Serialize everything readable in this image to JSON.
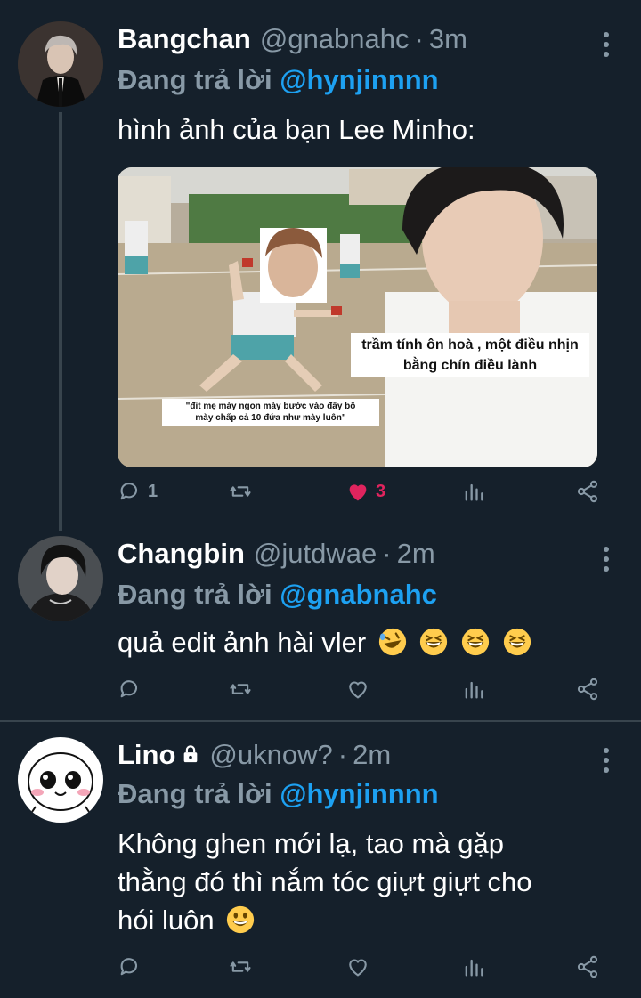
{
  "colors": {
    "background": "#15202b",
    "text_primary": "#ffffff",
    "text_secondary": "#8899a6",
    "link": "#1da1f2",
    "like_active": "#e0245e",
    "divider": "#38444d"
  },
  "tweets": [
    {
      "name": "Bangchan",
      "handle": "@gnabnahc",
      "dot": "·",
      "time": "3m",
      "reply_prefix": "Đang trả lời",
      "reply_to": "@hynjinnnn",
      "text": "hình ảnh của bạn Lee Minho:",
      "media": {
        "caption_right_line1": "trầm tính ôn hoà , một điều nhịn",
        "caption_right_line2": "bằng chín điều lành",
        "caption_left_line1": "\"địt mẹ mày ngon mày bước vào đây bố",
        "caption_left_line2": "mày chấp cả 10 đứa như mày luôn\""
      },
      "reply_count": "1",
      "like_count": "3",
      "liked": true
    },
    {
      "name": "Changbin",
      "handle": "@jutdwae",
      "dot": "·",
      "time": "2m",
      "reply_prefix": "Đang trả lời",
      "reply_to": "@gnabnahc",
      "text": "quả edit ảnh hài vler",
      "emojis": [
        "rolling-on-floor-laughing",
        "grinning-squinting",
        "grinning-squinting",
        "grinning-squinting"
      ]
    },
    {
      "name": "Lino",
      "handle": "@uknow?",
      "dot": "·",
      "time": "2m",
      "reply_prefix": "Đang trả lời",
      "reply_to": "@hynjinnnn",
      "text_line1": "Không ghen mới lạ, tao mà gặp",
      "text_line2": "thằng đó thì nắm tóc giựt giựt cho",
      "text_line3": "hói luôn",
      "emoji": "grinning-face",
      "locked": true
    }
  ]
}
